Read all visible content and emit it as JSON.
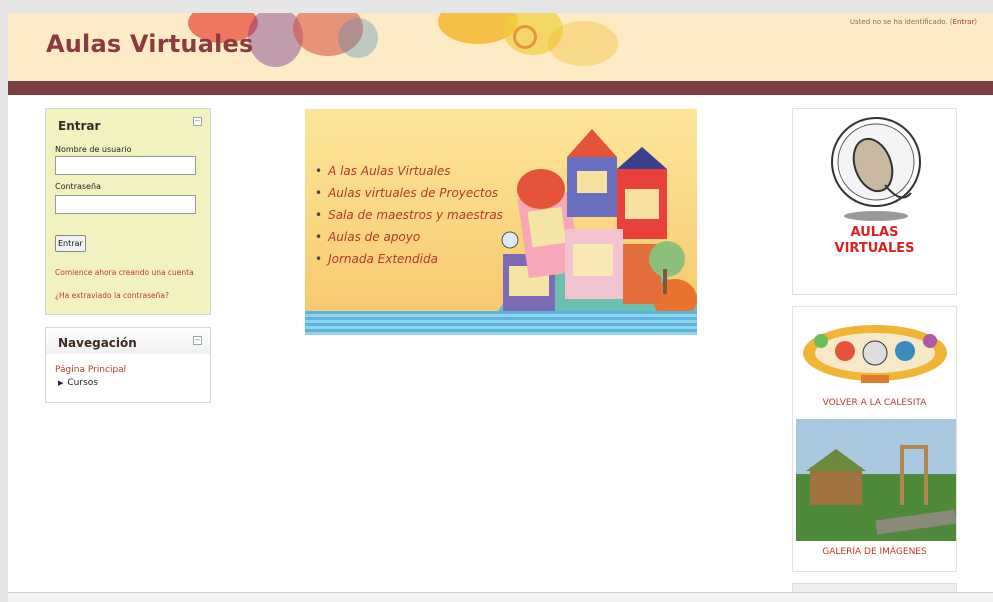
{
  "header": {
    "site_title": "Aulas Virtuales",
    "login_prefix": "Usted no se ha identificado. (",
    "login_link": "Entrar",
    "login_suffix": ")"
  },
  "login_block": {
    "title": "Entrar",
    "username_label": "Nombre de usuario",
    "username_value": "",
    "password_label": "Contraseña",
    "password_value": "",
    "submit_label": "Entrar",
    "signup_link": "Comience ahora creando una cuenta",
    "forgot_link": "¿Ha extraviado la contraseña?",
    "collapse_icon": "minus-icon"
  },
  "nav_block": {
    "title": "Navegación",
    "home_link": "Página Principal",
    "courses_label": "Cursos",
    "courses_icon": "triangle-right-icon",
    "collapse_icon": "minus-icon"
  },
  "banner": {
    "items": [
      "A las Aulas Virtuales",
      "Aulas virtuales de Proyectos",
      "Sala de maestros y maestras",
      "Aulas de apoyo",
      "Jornada Extendida"
    ]
  },
  "right_column": {
    "logo_text_1": "AULAS",
    "logo_text_2": "VIRTUALES",
    "calesita_caption": "VOLVER A LA CALESITA",
    "gallery_caption": "GALERÍA DE IMÁGENES"
  },
  "colors": {
    "header_bg": "#fdebc6",
    "bar": "#7b3f41",
    "title": "#8b3a3e",
    "link": "#c0392b",
    "login_block_bg": "#f2f2c0"
  }
}
